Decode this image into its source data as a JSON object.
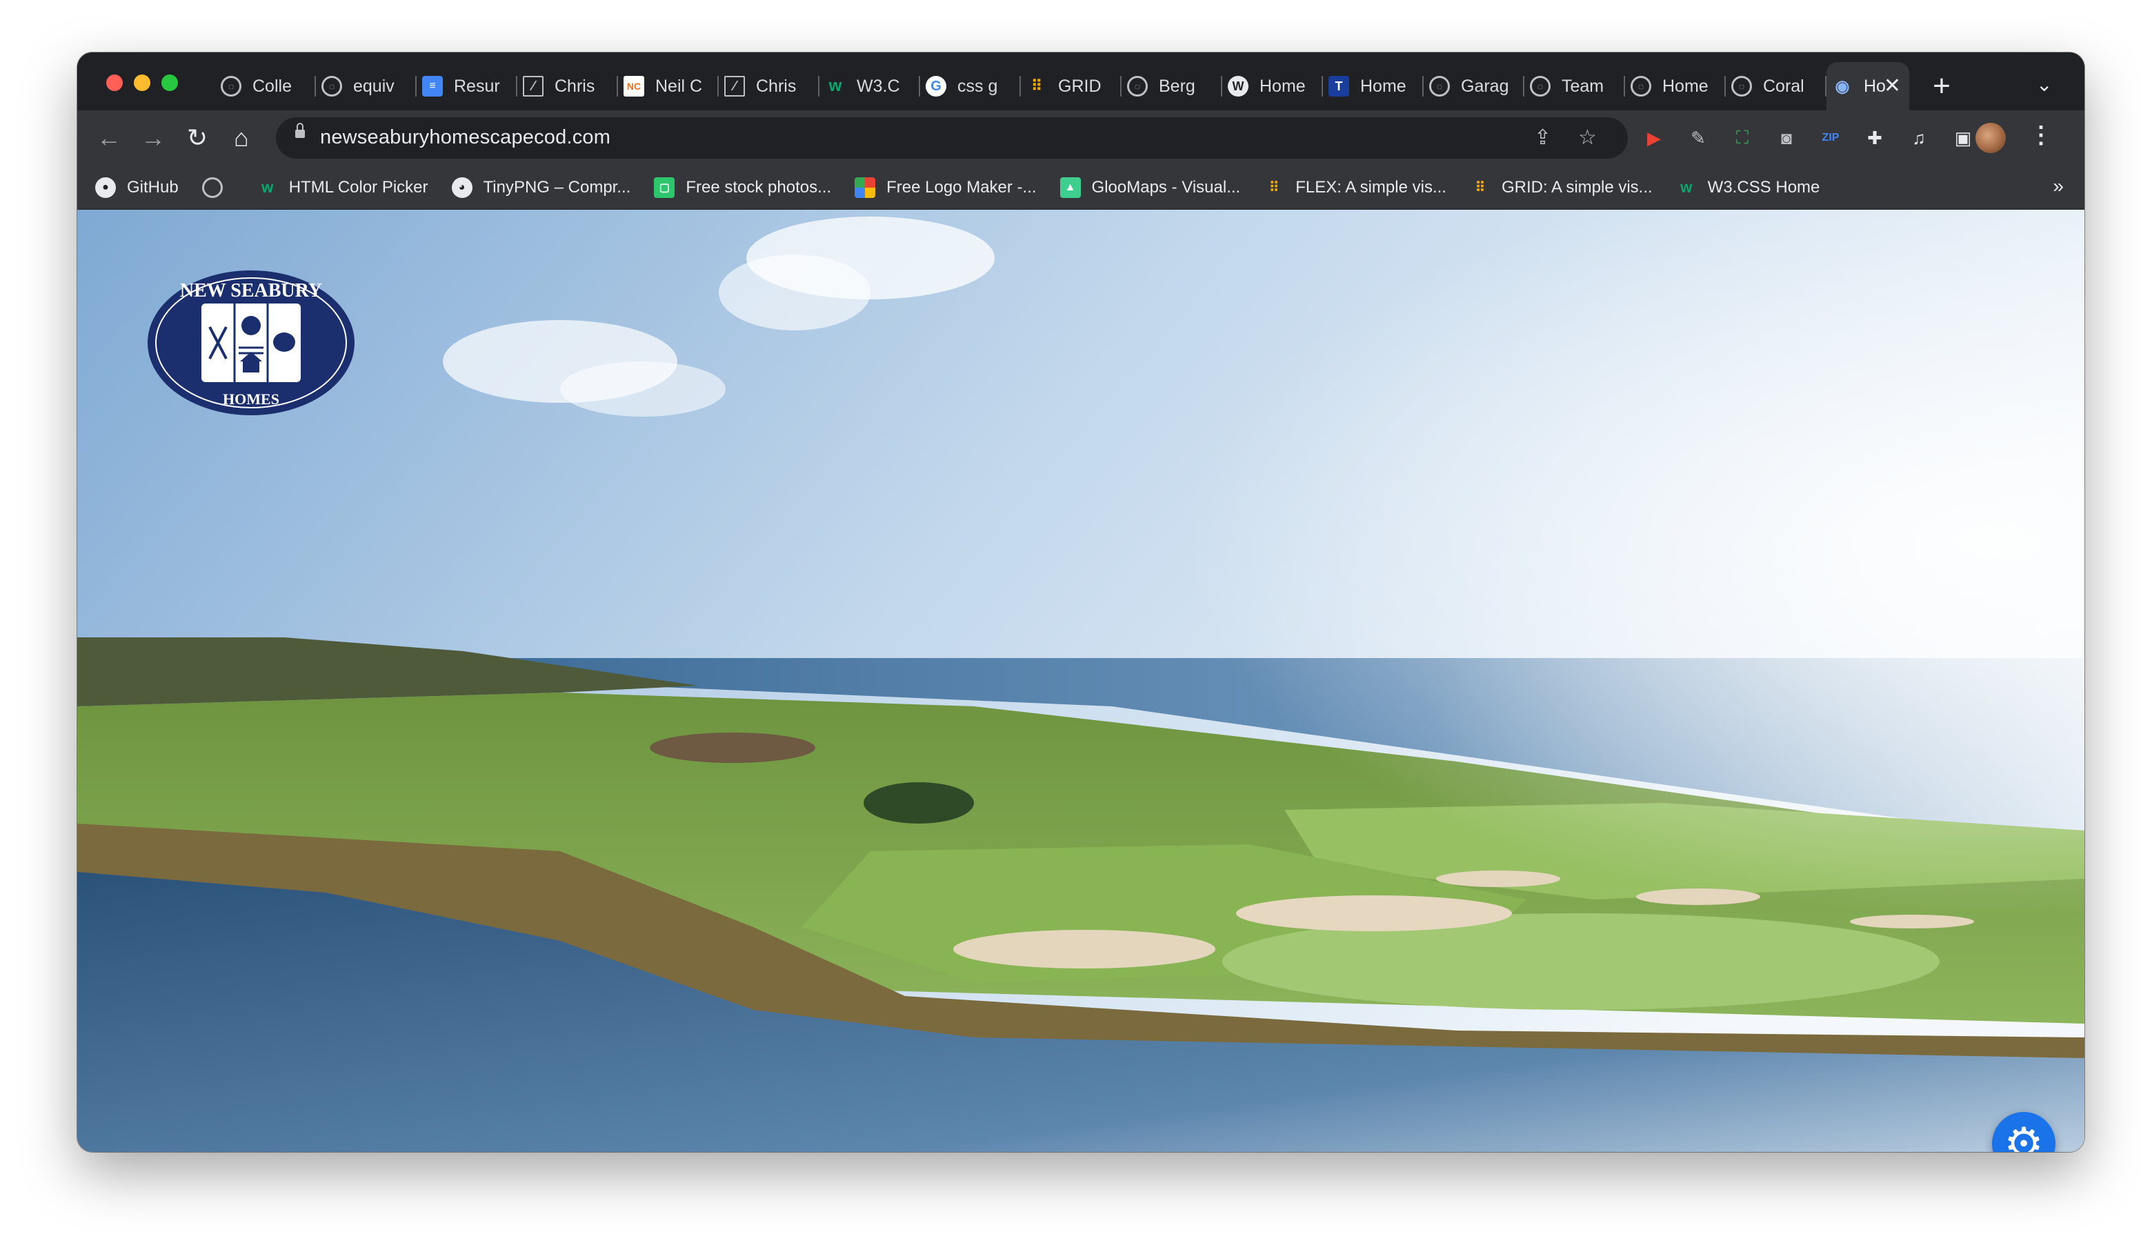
{
  "browser": {
    "tabs": [
      {
        "label": "Colle",
        "icon": "globe-icon"
      },
      {
        "label": "equiv",
        "icon": "globe-icon"
      },
      {
        "label": "Resur",
        "icon": "docs-icon"
      },
      {
        "label": "Chris",
        "icon": "slash-icon"
      },
      {
        "label": "Neil C",
        "icon": "nc-icon"
      },
      {
        "label": "Chris",
        "icon": "slash-icon"
      },
      {
        "label": "W3.C",
        "icon": "w3schools-icon"
      },
      {
        "label": "css g",
        "icon": "google-icon"
      },
      {
        "label": "GRID",
        "icon": "grid-icon"
      },
      {
        "label": "Berg",
        "icon": "globe-icon"
      },
      {
        "label": "Home",
        "icon": "wordpress-icon"
      },
      {
        "label": "Home",
        "icon": "blue-square-icon"
      },
      {
        "label": "Garag",
        "icon": "globe-icon"
      },
      {
        "label": "Team",
        "icon": "globe-icon"
      },
      {
        "label": "Home",
        "icon": "globe-icon"
      },
      {
        "label": "Coral",
        "icon": "globe-icon"
      },
      {
        "label": "Ho",
        "icon": "eye-icon",
        "active": true
      }
    ],
    "new_tab_label": "+",
    "address": {
      "url": "newseaburyhomescapecod.com"
    },
    "bookmarks": [
      {
        "label": "GitHub",
        "icon": "github-icon"
      },
      {
        "label": "",
        "icon": "globe-icon"
      },
      {
        "label": "HTML Color Picker",
        "icon": "w3schools-icon"
      },
      {
        "label": "TinyPNG – Compr...",
        "icon": "panda-icon"
      },
      {
        "label": "Free stock photos...",
        "icon": "stock-photo-icon"
      },
      {
        "label": "Free Logo Maker -...",
        "icon": "shapes-icon"
      },
      {
        "label": "GlooMaps - Visual...",
        "icon": "gloomaps-icon"
      },
      {
        "label": "FLEX: A simple vis...",
        "icon": "grid-icon"
      },
      {
        "label": "GRID: A simple vis...",
        "icon": "grid-icon"
      },
      {
        "label": "W3.CSS Home",
        "icon": "w3schools-icon"
      }
    ],
    "bookmarks_overflow": "»"
  },
  "page": {
    "logo": {
      "top_text": "NEW SEABURY",
      "bottom_text": "HOMES"
    },
    "settings_icon": "gear-icon"
  },
  "colors": {
    "chrome_dark": "#202124",
    "chrome_toolbar": "#35363a",
    "logo_navy": "#1b2f6e",
    "fab_blue": "#1a73e8"
  }
}
